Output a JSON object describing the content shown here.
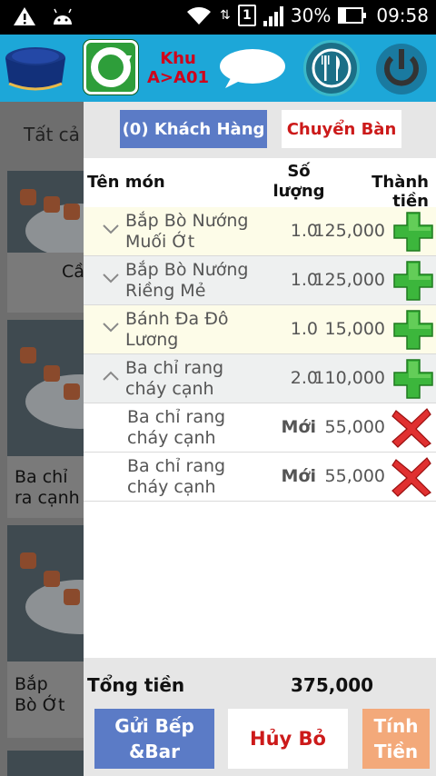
{
  "status_bar": {
    "battery": "30%",
    "time": "09:58",
    "sim": "1"
  },
  "toolbar": {
    "area_line1": "Khu",
    "area_line2": "A>A01"
  },
  "background_list": {
    "filter_label": "Tất cả",
    "card1_text": "Cầ",
    "card2_text": "Ba chỉ ra cạnh",
    "card3_text": "Bắp Bò Ớt"
  },
  "panel": {
    "customer_button": "(0) Khách Hàng",
    "move_table_button": "Chuyển Bàn",
    "columns": {
      "name": "Tên món",
      "qty": "Số lượng",
      "total": "Thành tiền"
    },
    "items": [
      {
        "name": "Bắp Bò Nướng Muối Ớt",
        "qty": "1.0",
        "price": "125,000"
      },
      {
        "name": "Bắp Bò Nướng Riềng Mẻ",
        "qty": "1.0",
        "price": "125,000"
      },
      {
        "name": "Bánh Đa Đô Lương",
        "qty": "1.0",
        "price": "15,000"
      },
      {
        "name": "Ba chỉ rang cháy cạnh",
        "qty": "2.0",
        "price": "110,000"
      }
    ],
    "sub_items": [
      {
        "name": "Ba chỉ rang cháy cạnh",
        "status": "Mới",
        "price": "55,000"
      },
      {
        "name": "Ba chỉ rang cháy cạnh",
        "status": "Mới",
        "price": "55,000"
      }
    ],
    "total_label": "Tổng tiền",
    "total_value": "375,000",
    "send_button": "Gửi Bếp &Bar",
    "cancel_button": "Hủy Bỏ",
    "pay_button": "Tính Tiền"
  },
  "icons": {
    "wifi": "wifi-icon",
    "warning": "warning-icon",
    "android": "android-icon",
    "plus": "plus-icon",
    "delete": "x-icon",
    "power": "power-icon",
    "menu": "fork-knife-icon"
  },
  "colors": {
    "toolbar": "#1da7d8",
    "primary_button": "#5b7bc6",
    "danger_text": "#cc1a1a",
    "pay_button": "#f3a97a"
  }
}
